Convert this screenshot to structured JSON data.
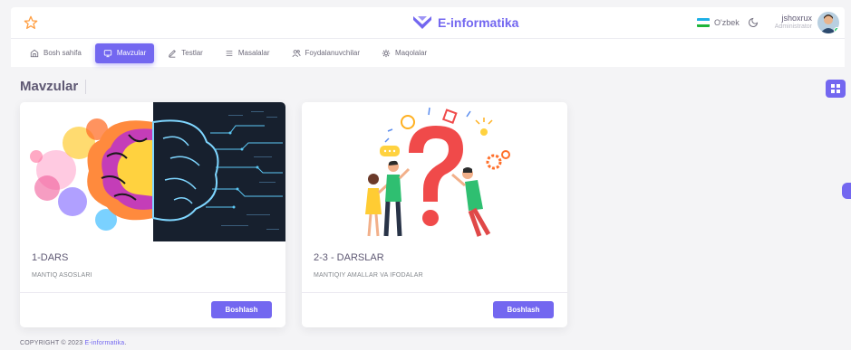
{
  "header": {
    "brand": "E-informatika",
    "language": "O'zbek",
    "user_name": "jshoxrux",
    "user_role": "Administrator"
  },
  "menu": {
    "items": [
      {
        "label": "Bosh sahifa",
        "icon": "home-icon"
      },
      {
        "label": "Mavzular",
        "icon": "board-icon"
      },
      {
        "label": "Testlar",
        "icon": "pen-icon"
      },
      {
        "label": "Masalalar",
        "icon": "list-icon"
      },
      {
        "label": "Foydalanuvchilar",
        "icon": "users-icon"
      },
      {
        "label": "Maqolalar",
        "icon": "gear-icon"
      }
    ],
    "active_index": 1
  },
  "page": {
    "title": "Mavzular"
  },
  "cards": [
    {
      "title": "1-DARS",
      "subtitle": "MANTIQ ASOSLARI",
      "button": "Boshlash",
      "image": "brain-illustration"
    },
    {
      "title": "2-3 - DARSLAR",
      "subtitle": "MANTIQIY AMALLAR VA IFODALAR",
      "button": "Boshlash",
      "image": "question-mark-illustration"
    }
  ],
  "footer": {
    "copyright": "COPYRIGHT © 2023",
    "link": "E-informatika",
    "suffix": "."
  },
  "colors": {
    "primary": "#7367f0",
    "background": "#f4f4f6",
    "card": "#ffffff",
    "text": "#5e5873"
  }
}
